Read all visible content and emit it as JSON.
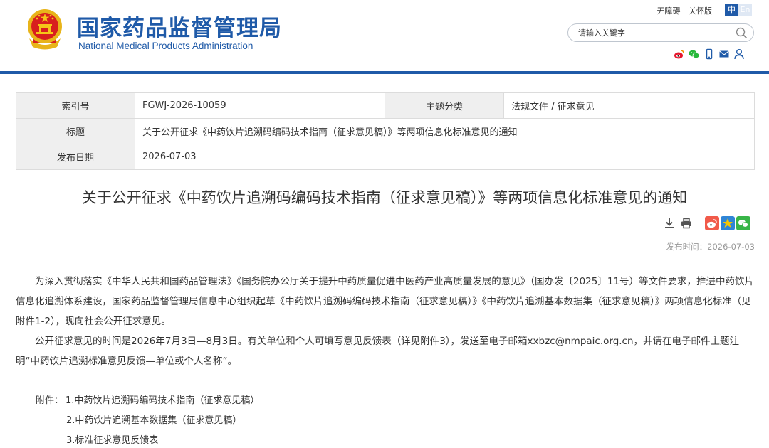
{
  "site": {
    "title_cn": "国家药品监督管理局",
    "title_en": "National Medical Products Administration",
    "top_links": [
      "无障碍",
      "关怀版"
    ],
    "lang": {
      "zh": "中",
      "en": "En"
    },
    "search_placeholder": "请输入关键字",
    "accent_color": "#1f5aa8",
    "social_icons": [
      "weibo-icon",
      "wechat-icon",
      "mobile-icon",
      "mail-icon",
      "user-icon"
    ]
  },
  "info_table": {
    "index_label": "索引号",
    "index_value": "FGWJ-2026-10059",
    "category_label": "主题分类",
    "category_value": "法规文件 / 征求意见",
    "title_label": "标题",
    "title_value": "关于公开征求《中药饮片追溯码编码技术指南（征求意见稿）》等两项信息化标准意见的通知",
    "date_label": "发布日期",
    "date_value": "2026-07-03"
  },
  "article": {
    "title": "关于公开征求《中药饮片追溯码编码技术指南（征求意见稿）》等两项信息化标准意见的通知",
    "tool_icons": [
      "download-icon",
      "print-icon",
      "share-weibo-icon",
      "share-qzone-icon",
      "share-wechat-icon"
    ],
    "pub_time": "发布时间：2026-07-03",
    "paragraph1": "为深入贯彻落实《中华人民共和国药品管理法》《国务院办公厅关于提升中药质量促进中医药产业高质量发展的意见》（国办发〔2025〕11号）等文件要求，推进中药饮片信息化追溯体系建设，国家药品监督管理局信息中心组织起草《中药饮片追溯码编码技术指南（征求意见稿）》《中药饮片追溯基本数据集（征求意见稿）》两项信息化标准（见附件1-2），现向社会公开征求意见。",
    "paragraph2": "公开征求意见的时间是2026年7月3日—8月3日。有关单位和个人可填写意见反馈表（详见附件3），发送至电子邮箱xxbzc@nmpaic.org.cn，并请在电子邮件主题注明“中药饮片追溯标准意见反馈—单位或个人名称”。",
    "attachments_label": "附件：",
    "attachments": [
      "1.中药饮片追溯码编码技术指南（征求意见稿）",
      "2.中药饮片追溯基本数据集（征求意见稿）",
      "3.标准征求意见反馈表"
    ]
  }
}
